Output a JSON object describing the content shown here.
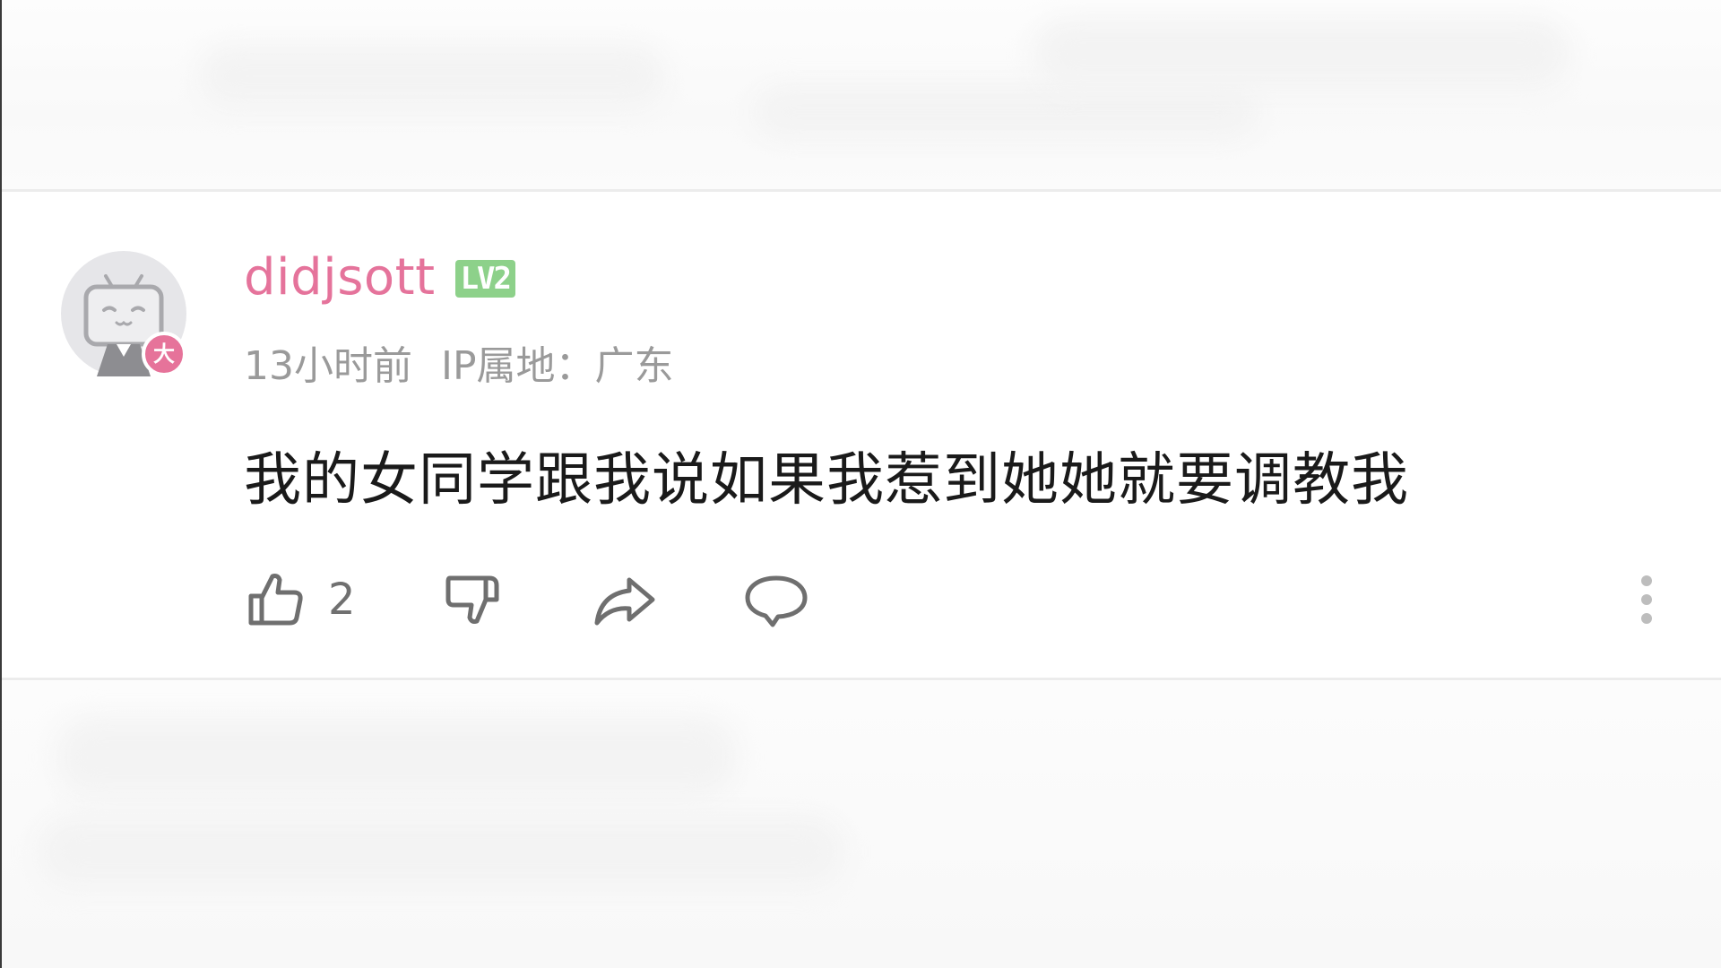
{
  "comment": {
    "username": "didjsott",
    "level_badge": "LV2",
    "avatar_badge_char": "大",
    "time_ago": "13小时前",
    "ip_location": "IP属地：广东",
    "text": "我的女同学跟我说如果我惹到她她就要调教我",
    "like_count": "2",
    "actions": {
      "like_icon": "thumbs-up-icon",
      "dislike_icon": "thumbs-down-icon",
      "share_icon": "share-icon",
      "reply_icon": "comment-bubble-icon",
      "more_icon": "more-vertical-icon"
    }
  },
  "colors": {
    "username": "#e5739b",
    "level_badge_bg": "#8dd18a",
    "avatar_badge_bg": "#e6739a",
    "meta_text": "#9a9a9a",
    "content_text": "#1a1a1a",
    "icon_stroke": "#6f6f6f"
  }
}
